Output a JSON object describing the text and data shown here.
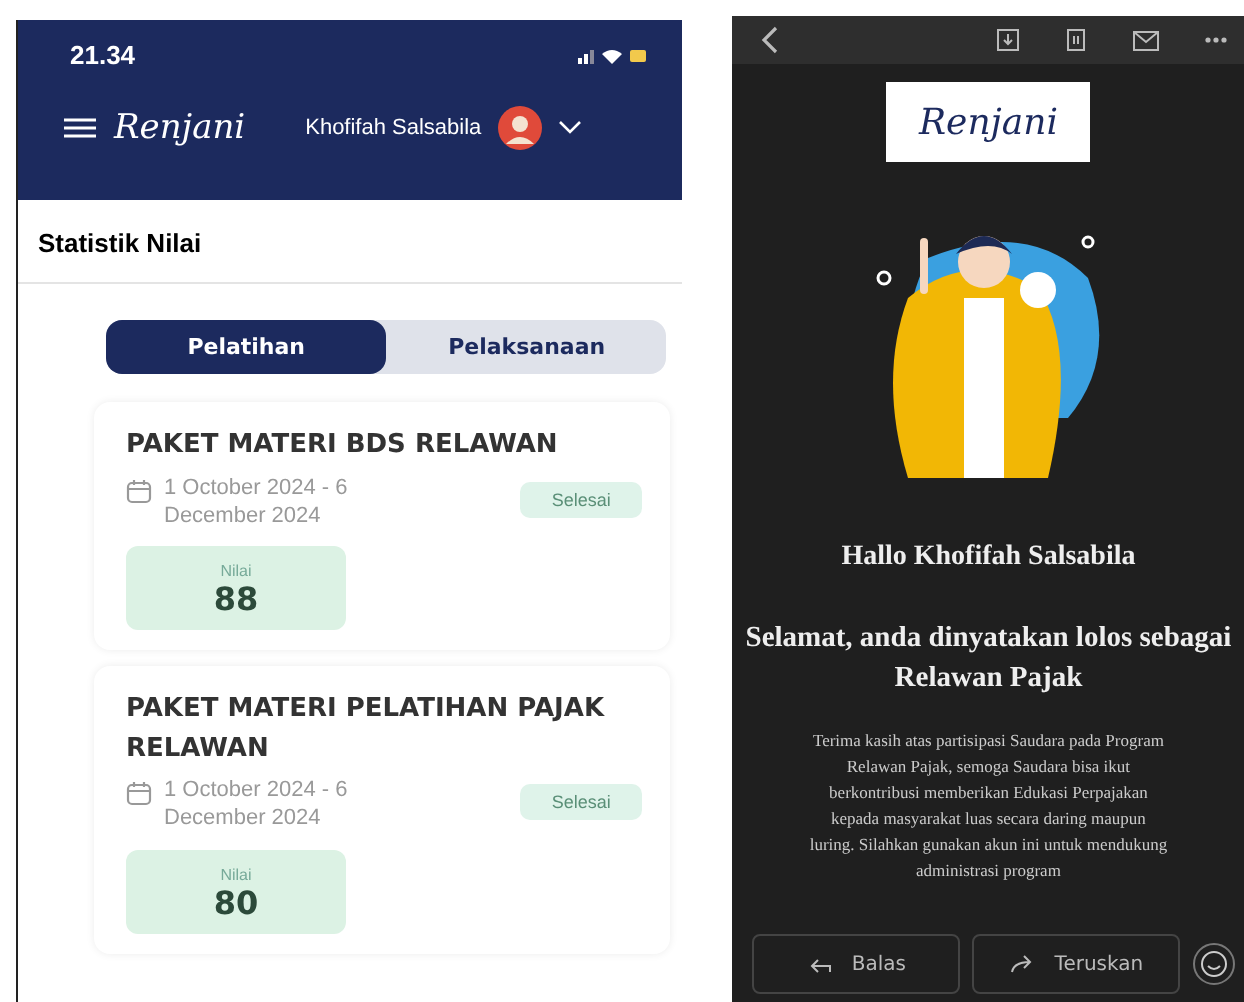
{
  "left": {
    "status_bar": {
      "time": "21.34"
    },
    "header": {
      "logo": "Renjani",
      "user_name": "Khofifah Salsabila"
    },
    "page_title": "Statistik Nilai",
    "tabs": [
      {
        "label": "Pelatihan",
        "selected": true
      },
      {
        "label": "Pelaksanaan",
        "selected": false
      }
    ],
    "cards": [
      {
        "title": "PAKET MATERI BDS RELAWAN",
        "date": "1 October 2024 - 6 December 2024",
        "status": "Selesai",
        "score_label": "Nilai",
        "score": "88"
      },
      {
        "title": "PAKET MATERI PELATIHAN PAJAK RELAWAN",
        "date": "1 October 2024 - 6 December 2024",
        "status": "Selesai",
        "score_label": "Nilai",
        "score": "80"
      }
    ]
  },
  "right": {
    "logo": "Renjani",
    "greeting": "Hallo Khofifah Salsabila",
    "heading": "Selamat, anda dinyatakan lolos sebagai Relawan Pajak",
    "body": "Terima kasih atas partisipasi Saudara pada Program Relawan Pajak, semoga Saudara bisa ikut berkontribusi memberikan Edukasi Perpajakan kepada masyarakat luas secara daring maupun luring. Silahkan gunakan akun ini untuk mendukung administrasi program",
    "buttons": [
      {
        "label": "Balas",
        "kind": "reply"
      },
      {
        "label": "Teruskan",
        "kind": "forward"
      }
    ]
  }
}
